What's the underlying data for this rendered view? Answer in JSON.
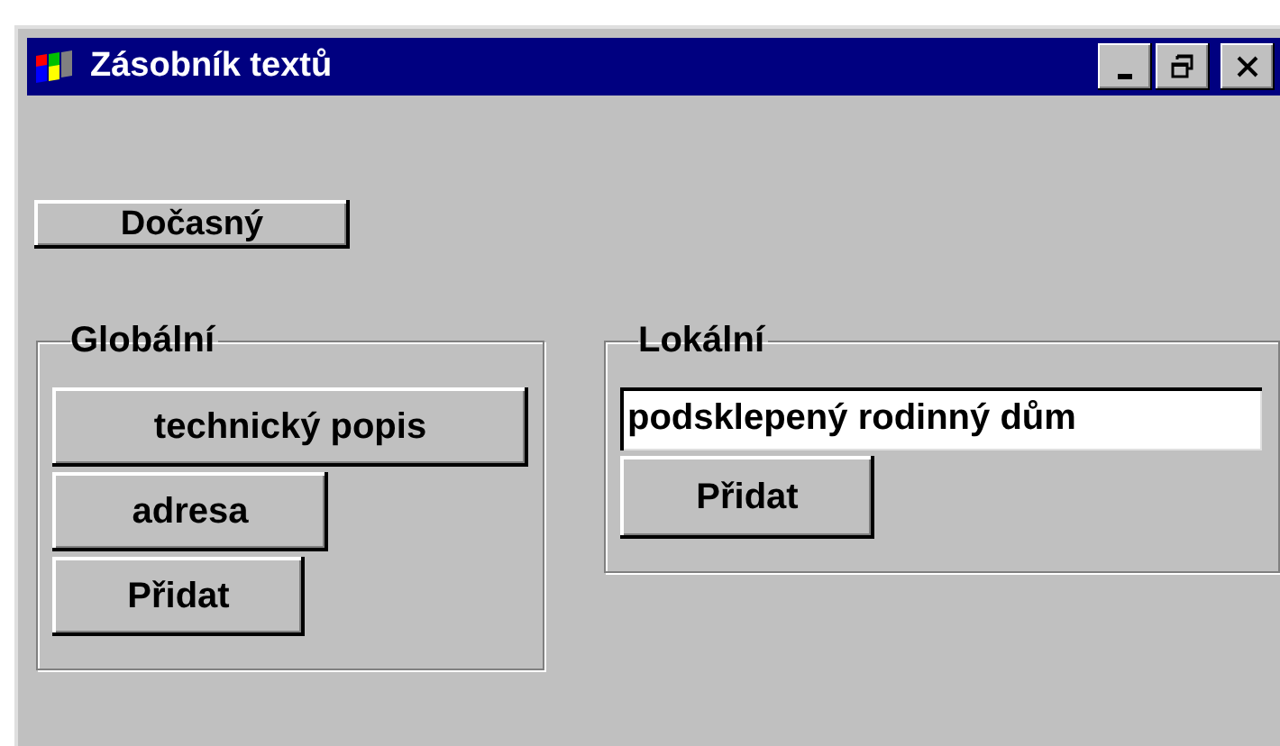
{
  "window": {
    "title": "Zásobník textů"
  },
  "temp_button": "Dočasný",
  "groups": [
    {
      "kind": "buttons",
      "title": "Globální",
      "buttons": [
        "technický popis",
        "adresa",
        "Přidat"
      ]
    },
    {
      "kind": "input",
      "title": "Lokální",
      "value": "podsklepený rodinný dům",
      "buttons": [
        "Přidat"
      ]
    }
  ]
}
